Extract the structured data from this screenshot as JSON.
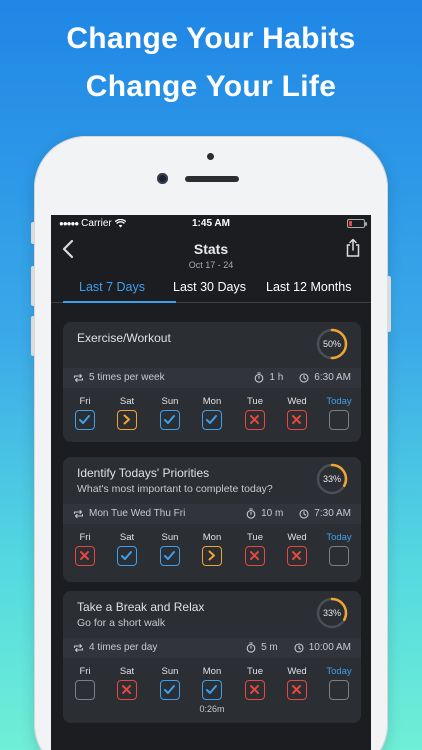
{
  "headline": {
    "line1": "Change Your Habits",
    "line2": "Change Your Life"
  },
  "status_bar": {
    "carrier": "Carrier",
    "time": "1:45 AM"
  },
  "nav": {
    "title": "Stats",
    "subtitle": "Oct 17 - 24"
  },
  "tabs": [
    {
      "label": "Last 7 Days",
      "active": true
    },
    {
      "label": "Last 30 Days",
      "active": false
    },
    {
      "label": "Last 12 Months",
      "active": false
    }
  ],
  "colors": {
    "accent": "#3ea0ec",
    "done": "#3ea0ec",
    "missed": "#e5483f",
    "skipped": "#f0a532",
    "ring": "#f0a532"
  },
  "habits": [
    {
      "title": "Exercise/Workout",
      "subtitle": "",
      "progress": 0.5,
      "progress_label": "50%",
      "frequency": "5 times per week",
      "duration": "1 h",
      "reminder": "6:30 AM",
      "days": [
        "Fri",
        "Sat",
        "Sun",
        "Mon",
        "Tue",
        "Wed",
        "Today"
      ],
      "status": [
        "check",
        "skip",
        "check",
        "check",
        "cross",
        "cross",
        "empty"
      ],
      "note": ""
    },
    {
      "title": "Identify Todays' Priorities",
      "subtitle": "What's most important to complete today?",
      "progress": 0.33,
      "progress_label": "33%",
      "frequency": "Mon Tue Wed Thu Fri",
      "duration": "10 m",
      "reminder": "7:30 AM",
      "days": [
        "Fri",
        "Sat",
        "Sun",
        "Mon",
        "Tue",
        "Wed",
        "Today"
      ],
      "status": [
        "cross",
        "check",
        "check",
        "skip",
        "cross",
        "cross",
        "empty"
      ],
      "note": ""
    },
    {
      "title": "Take a Break and Relax",
      "subtitle": "Go for a short walk",
      "progress": 0.33,
      "progress_label": "33%",
      "frequency": "4 times per day",
      "duration": "5 m",
      "reminder": "10:00 AM",
      "days": [
        "Fri",
        "Sat",
        "Sun",
        "Mon",
        "Tue",
        "Wed",
        "Today"
      ],
      "status": [
        "empty",
        "cross",
        "check",
        "check",
        "cross",
        "cross",
        "empty"
      ],
      "note": "0:26m"
    }
  ]
}
